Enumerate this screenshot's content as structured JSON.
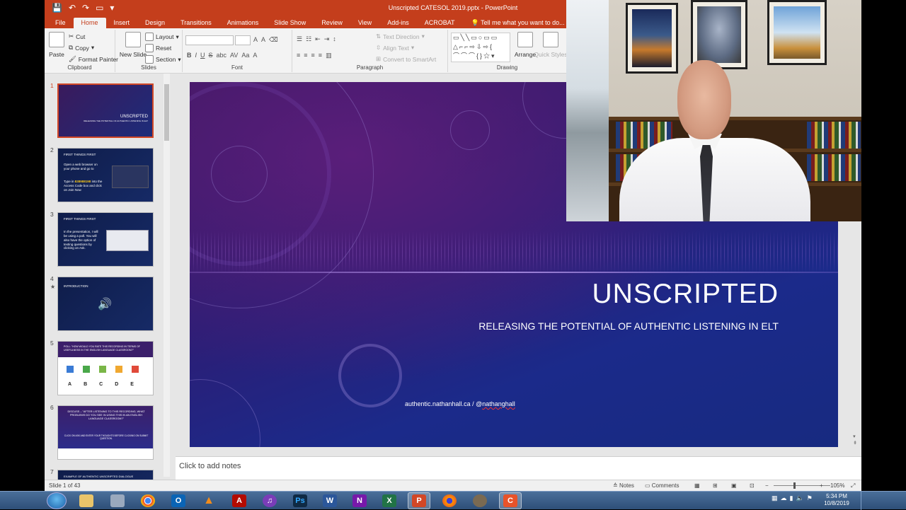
{
  "window": {
    "title": "Unscripted CATESOL 2019.pptx - PowerPoint"
  },
  "tabs": [
    "File",
    "Home",
    "Insert",
    "Design",
    "Transitions",
    "Animations",
    "Slide Show",
    "Review",
    "View",
    "Add-ins",
    "ACROBAT"
  ],
  "active_tab": "Home",
  "tell_me": "Tell me what you want to do...",
  "ribbon": {
    "clipboard": {
      "paste": "Paste",
      "cut": "Cut",
      "copy": "Copy",
      "format_painter": "Format Painter",
      "label": "Clipboard"
    },
    "slides": {
      "new_slide": "New Slide",
      "layout": "Layout",
      "reset": "Reset",
      "section": "Section",
      "label": "Slides"
    },
    "font": {
      "label": "Font",
      "bold": "B",
      "italic": "I",
      "underline": "U",
      "strike": "S",
      "shadow": "abc"
    },
    "paragraph": {
      "label": "Paragraph",
      "text_direction": "Text Direction",
      "align_text": "Align Text",
      "convert": "Convert to SmartArt"
    },
    "drawing": {
      "label": "Drawing",
      "arrange": "Arrange",
      "quick_styles": "Quick Styles"
    }
  },
  "thumbnails": [
    {
      "num": "1",
      "title": "UNSCRIPTED",
      "sub": "RELEASING THE POTENTIAL OF AUTHENTIC LISTENING IN ELT"
    },
    {
      "num": "2",
      "title": "FIRST THINGS FIRST",
      "sub": "Open a web browser on your phone and go to",
      "code_prefix": "Type in",
      "code": "838988198",
      "code_suffix": "into the Access Code box and click on Join Now"
    },
    {
      "num": "3",
      "title": "FIRST THINGS FIRST",
      "sub": "In the presentation, I will be using a poll. You will also have the option of texting questions by clicking on Ask."
    },
    {
      "num": "4",
      "title": "INTRODUCTION",
      "sub": ""
    },
    {
      "num": "5",
      "title": "POLL: \"HOW WOULD YOU RATE THIS RECORDING IN TERMS OF USEFULNESS IN THE ENGLISH LANGUAGE CLASSROOM?\"",
      "letters": [
        "A",
        "B",
        "C",
        "D",
        "E"
      ]
    },
    {
      "num": "6",
      "title": "DISCUSS – \"AFTER LISTENING TO THIS RECORDING, WHAT PROBLEMS DO YOU SEE IN USING THIS IN AN ENGLISH LANGUAGE CLASSROOM?\"",
      "sub": "CLICK ON ASK AND ENTER YOUR THOUGHTS BEFORE CLICKING ON SUBMIT QUESTION."
    },
    {
      "num": "7",
      "title": "EXAMPLE OF AUTHENTIC UNSCRIPTED DIALOGUE",
      "sub": ""
    }
  ],
  "slide": {
    "title": "UNSCRIPTED",
    "subtitle": "RELEASING THE POTENTIAL OF AUTHENTIC LISTENING IN ELT",
    "link_prefix": "authentic.nathanhall.ca / @",
    "link_handle": "nathanghall"
  },
  "notes_placeholder": "Click to add notes",
  "status": {
    "slide_of": "Slide 1 of 43",
    "notes": "Notes",
    "comments": "Comments",
    "zoom": "105%"
  },
  "taskbar": {
    "apps": [
      "File Explorer",
      "Calculator",
      "Chrome",
      "Outlook",
      "VLC",
      "Acrobat",
      "Headset",
      "Photoshop",
      "Word",
      "OneNote",
      "Excel",
      "PowerPoint",
      "Firefox",
      "GIMP",
      "Camtasia"
    ],
    "time": "5:34 PM",
    "date": "10/8/2019"
  },
  "colors": {
    "accent": "#c43e1c",
    "selected_border": "#d24726",
    "taskbar": "#2e4f78"
  }
}
